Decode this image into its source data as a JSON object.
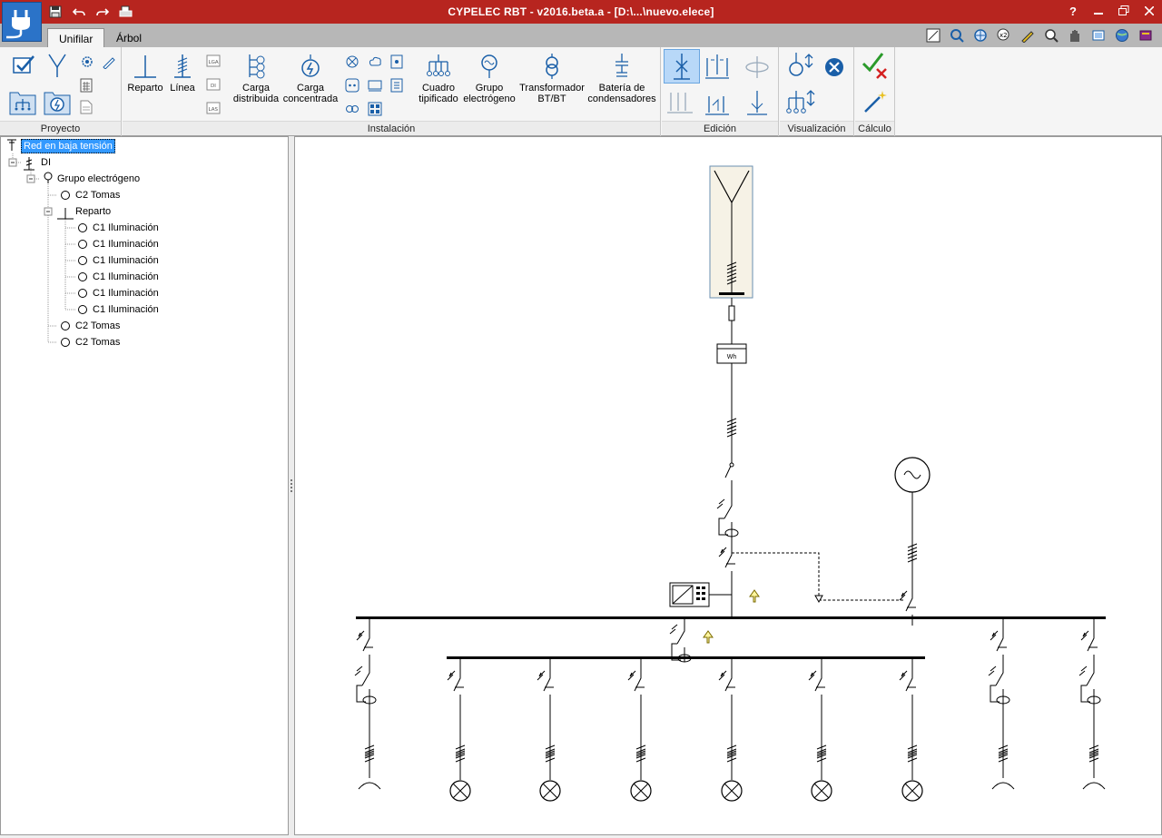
{
  "window": {
    "title": "CYPELEC RBT - v2016.beta.a - [D:\\...\\nuevo.elece]",
    "help": "?"
  },
  "tabs": [
    {
      "label": "Unifilar"
    },
    {
      "label": "Árbol"
    }
  ],
  "ribbon": {
    "proyecto": {
      "label": "Proyecto"
    },
    "instalacion": {
      "label": "Instalación",
      "reparto": "Reparto",
      "linea": "Línea",
      "small_lga": "LGA",
      "small_di": "DI",
      "small_las": "LAS",
      "carga_distribuida": [
        "Carga",
        "distribuida"
      ],
      "carga_concentrada": [
        "Carga",
        "concentrada"
      ],
      "cuadro_tipificado": [
        "Cuadro",
        "tipificado"
      ],
      "grupo_electrogeno": [
        "Grupo",
        "electrógeno"
      ],
      "transformador": [
        "Transformador",
        "BT/BT"
      ],
      "bateria": [
        "Batería de",
        "condensadores"
      ]
    },
    "edicion": {
      "label": "Edición"
    },
    "visualizacion": {
      "label": "Visualización"
    },
    "calculo": {
      "label": "Cálculo"
    }
  },
  "tree": {
    "root": "Red en baja tensión",
    "di": "DI",
    "grupo": "Grupo electrógeno",
    "c2_a": "C2 Tomas",
    "reparto": "Reparto",
    "lights": [
      "C1 Iluminación",
      "C1 Iluminación",
      "C1 Iluminación",
      "C1 Iluminación",
      "C1 Iluminación",
      "C1 Iluminación"
    ],
    "c2_b": "C2 Tomas",
    "c2_c": "C2 Tomas"
  },
  "diagram": {
    "meter_label": "Wh"
  },
  "colors": {
    "titlebar": "#b7251f",
    "accent_blue": "#1a5fa8",
    "selection": "#3399ff",
    "ok_green": "#2a9a2a",
    "cancel_red": "#d42020"
  }
}
